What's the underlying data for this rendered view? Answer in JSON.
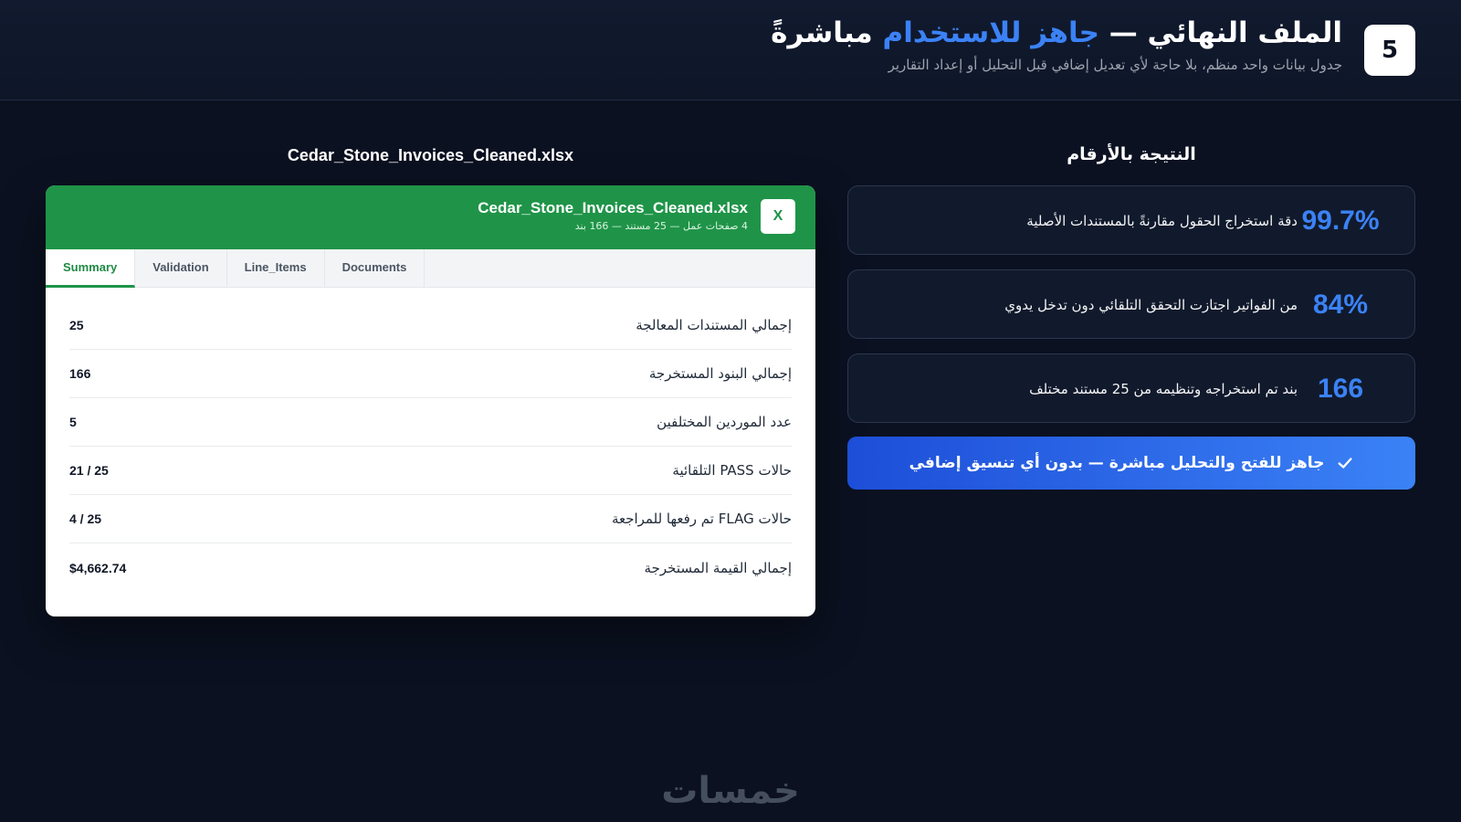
{
  "header": {
    "step_number": "5",
    "title_part1": "الملف النهائي — ",
    "title_accent": "جاهز للاستخدام",
    "title_part2": " مباشرةً",
    "subtitle": "جدول بيانات واحد منظم، بلا حاجة لأي تعديل إضافي قبل التحليل أو إعداد التقارير"
  },
  "file_preview": {
    "heading": "Cedar_Stone_Invoices_Cleaned.xlsx",
    "badge": "X",
    "file_name": "Cedar_Stone_Invoices_Cleaned.xlsx",
    "meta": "4 صفحات عمل — 25 مستند — 166 بند",
    "accent_color": "#1f9448",
    "tabs": [
      {
        "label": "Summary",
        "active": true
      },
      {
        "label": "Validation",
        "active": false
      },
      {
        "label": "Line_Items",
        "active": false
      },
      {
        "label": "Documents",
        "active": false
      }
    ],
    "summary_rows": [
      {
        "label": "إجمالي المستندات المعالجة",
        "value": "25"
      },
      {
        "label": "إجمالي البنود المستخرجة",
        "value": "166"
      },
      {
        "label": "عدد الموردين المختلفين",
        "value": "5"
      },
      {
        "label": "حالات PASS التلقائية",
        "value": "21 / 25"
      },
      {
        "label": "حالات FLAG تم رفعها للمراجعة",
        "value": "4 / 25"
      },
      {
        "label": "إجمالي القيمة المستخرجة",
        "value": "$4,662.74"
      }
    ]
  },
  "results": {
    "heading": "النتيجة بالأرقام",
    "accent_color": "#3b82f6",
    "stats": [
      {
        "value": "99.7%",
        "text": "دقة استخراج الحقول مقارنةً بالمستندات الأصلية"
      },
      {
        "value": "84%",
        "text": "من الفواتير اجتازت التحقق التلقائي دون تدخل يدوي"
      },
      {
        "value": "166",
        "text": "بند تم استخراجه وتنظيمه من 25 مستند مختلف"
      }
    ],
    "ready_banner": "جاهز للفتح والتحليل مباشرة — بدون أي تنسيق إضافي",
    "ready_icon": "check-icon"
  },
  "footer": {
    "logo_text": "خمسات"
  }
}
